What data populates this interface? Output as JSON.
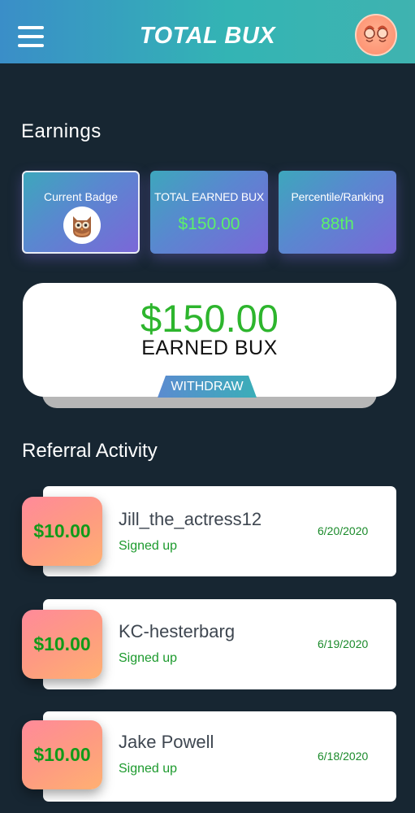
{
  "header": {
    "title": "TOTAL BUX",
    "menu_icon": "hamburger-menu-icon",
    "avatar_icon": "user-avatar-icon"
  },
  "earnings": {
    "title": "Earnings",
    "cards": [
      {
        "label": "Current Badge",
        "icon": "owl-badge-icon"
      },
      {
        "label": "TOTAL EARNED BUX",
        "value": "$150.00"
      },
      {
        "label": "Percentile/Ranking",
        "value": "88th"
      }
    ],
    "earned": {
      "amount": "$150.00",
      "label": "EARNED BUX",
      "withdraw_label": "WITHDRAW"
    }
  },
  "referrals": {
    "title": "Referral Activity",
    "items": [
      {
        "amount": "$10.00",
        "name": "Jill_the_actress12",
        "status": "Signed up",
        "date": "6/20/2020"
      },
      {
        "amount": "$10.00",
        "name": "KC-hesterbarg",
        "status": "Signed up",
        "date": "6/19/2020"
      },
      {
        "amount": "$10.00",
        "name": "Jake Powell",
        "status": "Signed up",
        "date": "6/18/2020"
      }
    ]
  },
  "colors": {
    "header_start": "#3a8ec8",
    "header_end": "#3fb3b0",
    "background": "#172632",
    "accent_green": "#2db52d",
    "card_purple": "#7b67d8",
    "amount_badge": "#fe9a82"
  }
}
